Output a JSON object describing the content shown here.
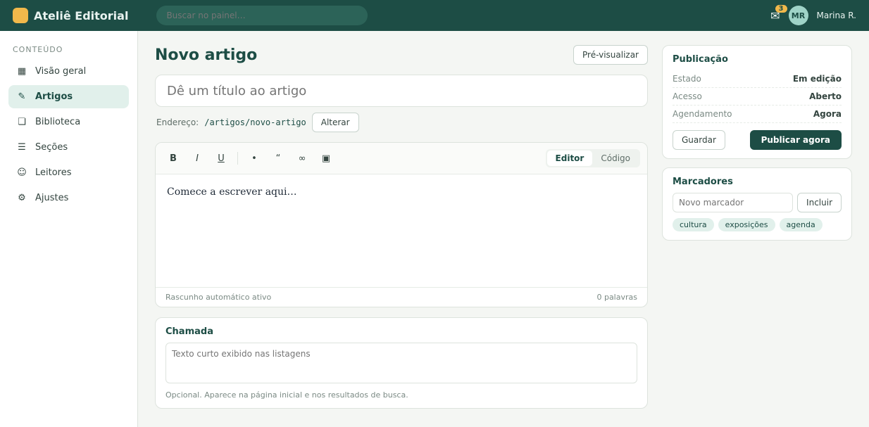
{
  "topbar": {
    "brand": "Ateliê Editorial",
    "search_placeholder": "Buscar no painel…",
    "notification_count": "3",
    "user_initials": "MR",
    "user_name": "Marina R."
  },
  "rail": {
    "heading": "Conteúdo",
    "items": [
      {
        "label": "Visão geral",
        "icon": "▦"
      },
      {
        "label": "Artigos",
        "icon": "✎"
      },
      {
        "label": "Biblioteca",
        "icon": "❏"
      },
      {
        "label": "Seções",
        "icon": "☰"
      },
      {
        "label": "Leitores",
        "icon": "☺"
      },
      {
        "label": "Ajustes",
        "icon": "⚙"
      }
    ]
  },
  "editor": {
    "page_title": "Novo artigo",
    "preview_label": "Pré-visualizar",
    "title_placeholder": "Dê um título ao artigo",
    "slug_label": "Endereço:",
    "slug_value": "/artigos/novo-artigo",
    "slug_edit_label": "Alterar",
    "mode_rich": "Editor",
    "mode_code": "Código",
    "body_placeholder": "Comece a escrever aqui…",
    "status_left": "Rascunho automático ativo",
    "status_right": "0 palavras",
    "excerpt_title": "Chamada",
    "excerpt_placeholder": "Texto curto exibido nas listagens",
    "excerpt_hint": "Opcional. Aparece na página inicial e nos resultados de busca."
  },
  "publish": {
    "title": "Publicação",
    "rows": [
      {
        "key": "Estado",
        "value": "Em edição"
      },
      {
        "key": "Acesso",
        "value": "Aberto"
      },
      {
        "key": "Agendamento",
        "value": "Agora"
      }
    ],
    "save_label": "Guardar",
    "publish_label": "Publicar agora"
  },
  "tags": {
    "title": "Marcadores",
    "input_placeholder": "Novo marcador",
    "add_label": "Incluir",
    "chips": [
      "cultura",
      "exposições",
      "agenda"
    ]
  },
  "colors": {
    "accent": "#1d4d45",
    "highlight": "#f1b84b"
  }
}
